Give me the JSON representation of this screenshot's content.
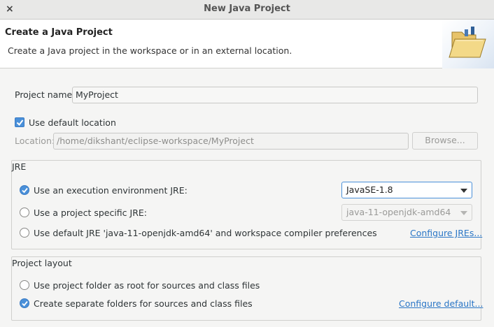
{
  "window": {
    "title": "New Java Project",
    "close_glyph": "×"
  },
  "header": {
    "title": "Create a Java Project",
    "description": "Create a Java project in the workspace or in an external location.",
    "banner_icon": "folder-icon"
  },
  "project_name": {
    "label": "Project name:",
    "value": "MyProject"
  },
  "default_location": {
    "label": "Use default location",
    "checked": true
  },
  "location": {
    "label": "Location:",
    "value": "/home/dikshant/eclipse-workspace/MyProject",
    "browse_label": "Browse..."
  },
  "jre": {
    "title": "JRE",
    "options": [
      {
        "label": "Use an execution environment JRE:",
        "selected": true
      },
      {
        "label": "Use a project specific JRE:",
        "selected": false
      },
      {
        "label": "Use default JRE 'java-11-openjdk-amd64' and workspace compiler preferences",
        "selected": false
      }
    ],
    "env_combo_value": "JavaSE-1.8",
    "specific_combo_value": "java-11-openjdk-amd64",
    "configure_link": "Configure JREs..."
  },
  "layout": {
    "title": "Project layout",
    "options": [
      {
        "label": "Use project folder as root for sources and class files",
        "selected": false
      },
      {
        "label": "Create separate folders for sources and class files",
        "selected": true
      }
    ],
    "configure_link": "Configure default..."
  },
  "colors": {
    "accent": "#4a90d9",
    "link": "#2a76c6"
  }
}
